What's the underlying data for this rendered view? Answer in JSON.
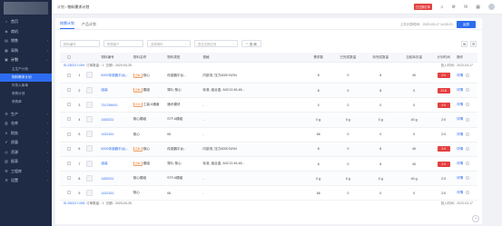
{
  "topbar": {
    "breadcrumb_home": "计划",
    "breadcrumb_sep": " / ",
    "breadcrumb_current": "物料需求计划",
    "badge": "已过期订单",
    "icons": [
      "bell-icon",
      "settings-icon",
      "message-icon",
      "grid-icon"
    ]
  },
  "sidebar": {
    "items": [
      {
        "label": "首页",
        "icon": "home-icon"
      },
      {
        "label": "商机",
        "icon": "opportunity-icon"
      },
      {
        "label": "销售",
        "icon": "sales-icon"
      },
      {
        "label": "采购",
        "icon": "purchase-icon"
      },
      {
        "label": "计划",
        "icon": "plan-icon"
      }
    ],
    "sub_items": [
      {
        "label": "主生产计划",
        "active": false
      },
      {
        "label": "物料需求计划",
        "active": true
      },
      {
        "label": "外协入库单",
        "active": false
      },
      {
        "label": "采购计划",
        "active": false
      },
      {
        "label": "采购单",
        "active": false
      }
    ],
    "bottom_items": [
      {
        "label": "生产",
        "icon": "production-icon"
      },
      {
        "label": "仓库",
        "icon": "warehouse-icon"
      },
      {
        "label": "财务",
        "icon": "finance-icon"
      },
      {
        "label": "质量",
        "icon": "quality-icon"
      },
      {
        "label": "资源",
        "icon": "resource-icon"
      },
      {
        "label": "报表",
        "icon": "report-icon"
      },
      {
        "label": "工程库",
        "icon": "engineering-icon"
      },
      {
        "label": "设置",
        "icon": "settings-icon"
      }
    ]
  },
  "content": {
    "tabs": [
      "按需计划",
      "产品计划"
    ],
    "sync_info": "上次计算时间：2023-03-17 14:30:21",
    "run_button": "运算",
    "filters": {
      "code_placeholder": "物料编号",
      "customer_placeholder": "所属客户",
      "type_placeholder": "选择物料",
      "status_placeholder": "是否交期正常",
      "search_button": "查 询"
    }
  },
  "table": {
    "headers": [
      "物料编号",
      "物料名称",
      "物料类型",
      "规格",
      "需求数",
      "已完成数量",
      "待完成数量",
      "当前库存量",
      "计划时间",
      "操作"
    ],
    "groups": [
      {
        "label": "SI-230317-009",
        "extra": "订单数量：1",
        "date": "交期：2023-03-25",
        "right": "投入时间：2023-03-17"
      },
      {
        "label": "SI-230317-008",
        "extra": "订单数量：1",
        "date": "交期：2023-03-25",
        "right": "投入时间：2023-03-17"
      }
    ],
    "rows": [
      {
        "idx": "1",
        "code": "6200传感器平台(...",
        "name": "核心",
        "type": "传感器平台...",
        "tag": "自制",
        "spec": "内部流, 压力6000 B294",
        "plan": "8",
        "done": "0",
        "left": "8",
        "stock": "40",
        "time": "2:0",
        "op": "详情"
      },
      {
        "idx": "2",
        "code": "组装",
        "name": "模组",
        "type": "薄片·核心",
        "tag": "自制",
        "spec": "标准, 组合盒, A0C13 45-48...",
        "plan": "8",
        "done": "0",
        "left": "8",
        "stock": "0",
        "time": "21:8",
        "op": "详情"
      },
      {
        "idx": "3",
        "code": "T417MMX1",
        "name": "工装·6通道",
        "type": "通讯模块",
        "tag": "外协",
        "spec": "-",
        "plan": "0",
        "done": "0",
        "left": "0",
        "stock": "0",
        "time": "2:0",
        "op": "详情"
      },
      {
        "idx": "4",
        "code": "1452021",
        "name": "核心模组",
        "type": "STF-6模组",
        "tag": "",
        "spec": "-",
        "plan": "0 g",
        "done": "0 g",
        "left": "0 g",
        "stock": "40 g",
        "time": "2:0",
        "op": "详情"
      },
      {
        "idx": "5",
        "code": "1432161",
        "name": "核心",
        "type": "06",
        "tag": "",
        "spec": "-",
        "plan": "66",
        "done": "0",
        "left": "0",
        "stock": "0",
        "time": "2:0",
        "op": "详情"
      },
      {
        "idx": "6",
        "code": "6200传感器平台(...",
        "name": "核心",
        "type": "传感器平台...",
        "tag": "自制",
        "spec": "内部流, 压力6000 B294",
        "plan": "8",
        "done": "0",
        "left": "8",
        "stock": "40",
        "time": "2:0",
        "op": "详情"
      },
      {
        "idx": "7",
        "code": "组装",
        "name": "模组",
        "type": "薄片·核心",
        "tag": "自制",
        "spec": "标准, 组合盒, A0C13 45-48...",
        "plan": "8",
        "done": "0",
        "left": "8",
        "stock": "40",
        "time": "2:0",
        "op": "详情"
      },
      {
        "idx": "8",
        "code": "1452021",
        "name": "核心模组",
        "type": "STF-6模组",
        "tag": "",
        "spec": "-",
        "plan": "0 g",
        "done": "0 g",
        "left": "0 g",
        "stock": "40 g",
        "time": "2:0",
        "op": "详情"
      },
      {
        "idx": "9",
        "code": "1432161",
        "name": "核心",
        "type": "06",
        "tag": "",
        "spec": "-",
        "plan": "66",
        "done": "0",
        "left": "0",
        "stock": "0",
        "time": "2:0",
        "op": "详情"
      }
    ],
    "red_rows": [
      0,
      1,
      2,
      5,
      6
    ]
  }
}
